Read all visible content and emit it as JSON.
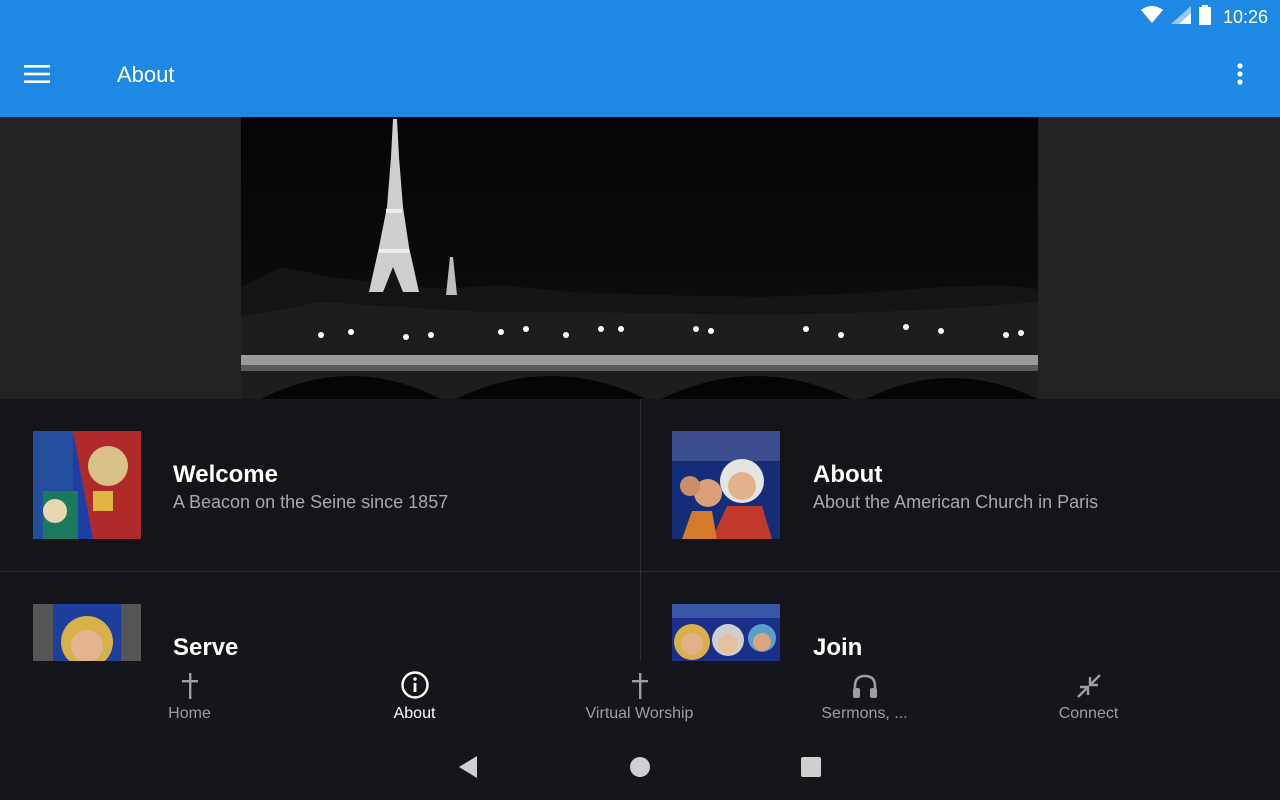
{
  "status_bar": {
    "time": "10:26",
    "icons": [
      "wifi-icon",
      "signal-icon",
      "battery-icon"
    ]
  },
  "app_bar": {
    "title": "About",
    "menu_icon": "hamburger-menu-icon",
    "overflow_icon": "more-vert-icon"
  },
  "hero": {
    "description_icon": "eiffel-tower-night-photo"
  },
  "tiles": [
    {
      "title": "Welcome",
      "subtitle": "A Beacon on the Seine since 1857",
      "thumb": "stained-glass-thumbnail"
    },
    {
      "title": "About",
      "subtitle": "About the American Church in Paris",
      "thumb": "stained-glass-thumbnail"
    },
    {
      "title": "Serve",
      "subtitle": "",
      "thumb": "stained-glass-thumbnail"
    },
    {
      "title": "Join",
      "subtitle": "",
      "thumb": "stained-glass-thumbnail"
    }
  ],
  "bottom_nav": {
    "items": [
      {
        "label": "Home",
        "icon": "cross-icon",
        "active": false
      },
      {
        "label": "About",
        "icon": "info-icon",
        "active": true
      },
      {
        "label": "Virtual Worship",
        "icon": "cross-icon",
        "active": false
      },
      {
        "label": "Sermons, ...",
        "icon": "headphones-icon",
        "active": false
      },
      {
        "label": "Connect",
        "icon": "collapse-arrows-icon",
        "active": false
      }
    ]
  },
  "colors": {
    "accent": "#1e88e5",
    "background": "#151619",
    "text_muted": "#a8a8a8"
  }
}
